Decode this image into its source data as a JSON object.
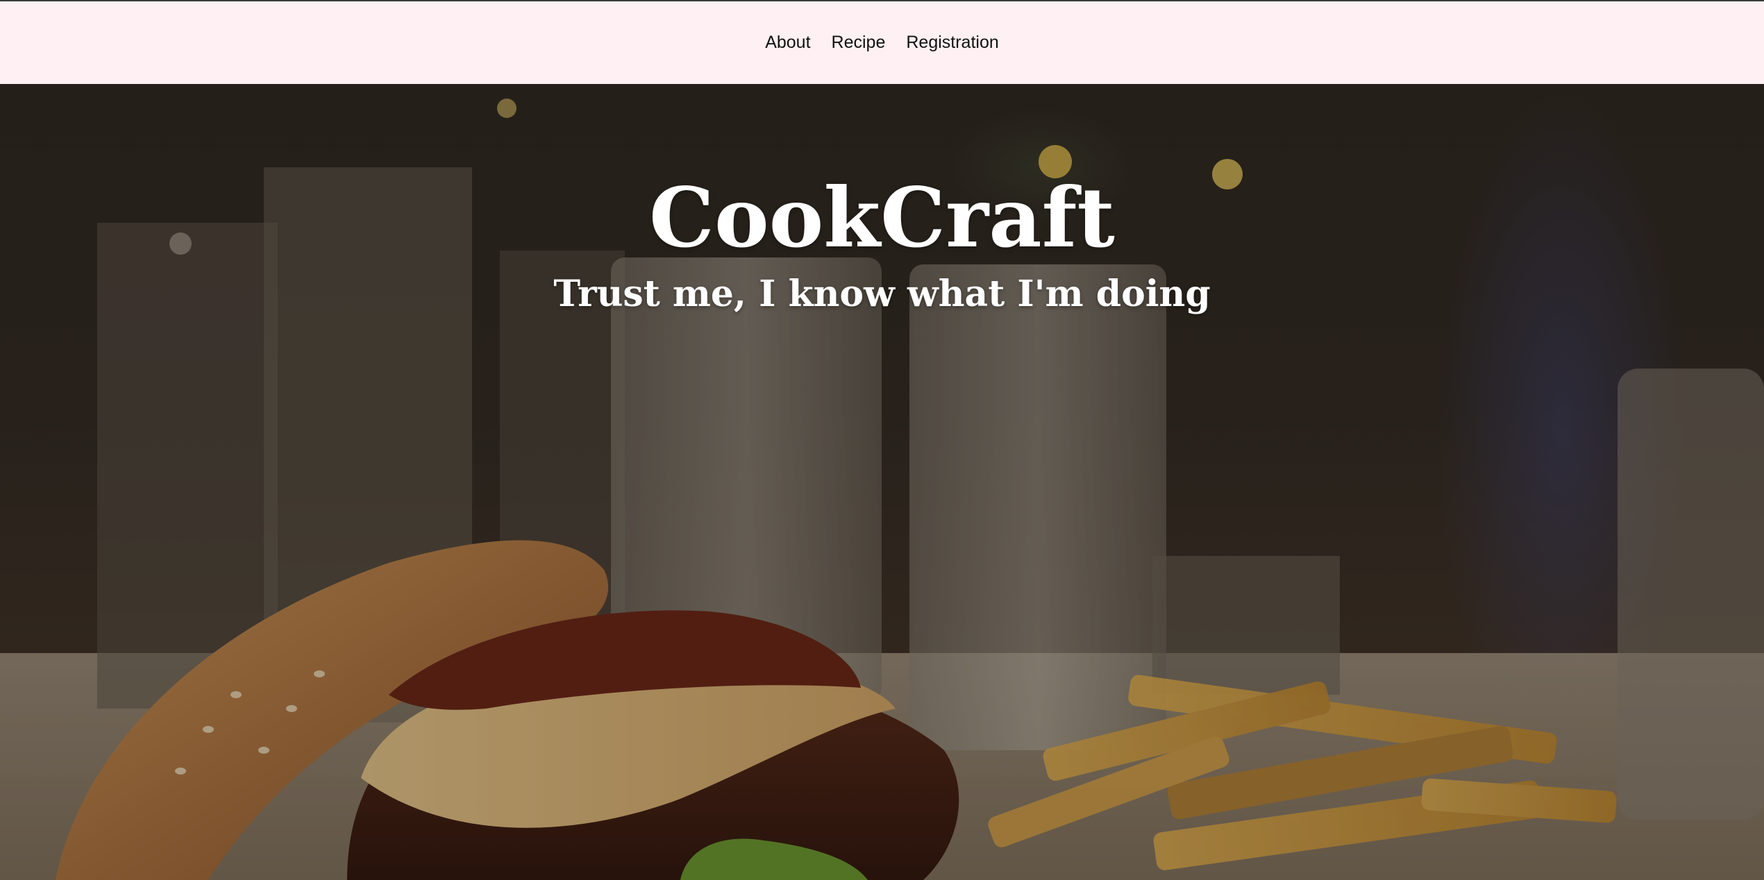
{
  "nav": {
    "items": [
      {
        "label": "About"
      },
      {
        "label": "Recipe"
      },
      {
        "label": "Registration"
      }
    ]
  },
  "hero": {
    "title": "CookCraft",
    "subtitle": "Trust me, I know what I'm doing",
    "image": "burger-and-fries-photo"
  },
  "colors": {
    "navbar_background": "#fff0f3",
    "nav_text": "#111111",
    "hero_text": "#ffffff"
  }
}
